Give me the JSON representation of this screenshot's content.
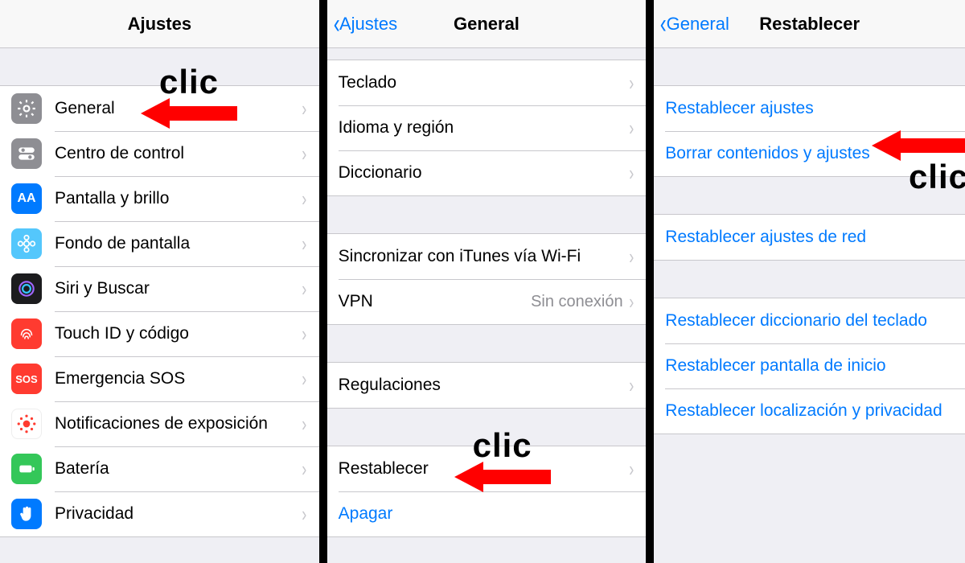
{
  "annotation_label": "clic",
  "panel1": {
    "title": "Ajustes",
    "rows": [
      {
        "label": "General"
      },
      {
        "label": "Centro de control"
      },
      {
        "label": "Pantalla y brillo"
      },
      {
        "label": "Fondo de pantalla"
      },
      {
        "label": "Siri y Buscar"
      },
      {
        "label": "Touch ID y código"
      },
      {
        "label": "Emergencia SOS"
      },
      {
        "label": "Notificaciones de exposición"
      },
      {
        "label": "Batería"
      },
      {
        "label": "Privacidad"
      }
    ]
  },
  "panel2": {
    "back": "Ajustes",
    "title": "General",
    "group1": [
      {
        "label": "Teclado"
      },
      {
        "label": "Idioma y región"
      },
      {
        "label": "Diccionario"
      }
    ],
    "group2": [
      {
        "label": "Sincronizar con iTunes vía Wi-Fi"
      },
      {
        "label": "VPN",
        "detail": "Sin conexión"
      }
    ],
    "group3": [
      {
        "label": "Regulaciones"
      }
    ],
    "group4": [
      {
        "label": "Restablecer"
      },
      {
        "label": "Apagar",
        "link": true,
        "no_chevron": true
      }
    ]
  },
  "panel3": {
    "back": "General",
    "title": "Restablecer",
    "group1": [
      {
        "label": "Restablecer ajustes"
      },
      {
        "label": "Borrar contenidos y ajustes"
      }
    ],
    "group2": [
      {
        "label": "Restablecer ajustes de red"
      }
    ],
    "group3": [
      {
        "label": "Restablecer diccionario del teclado"
      },
      {
        "label": "Restablecer pantalla de inicio"
      },
      {
        "label": "Restablecer localización y privacidad"
      }
    ]
  }
}
